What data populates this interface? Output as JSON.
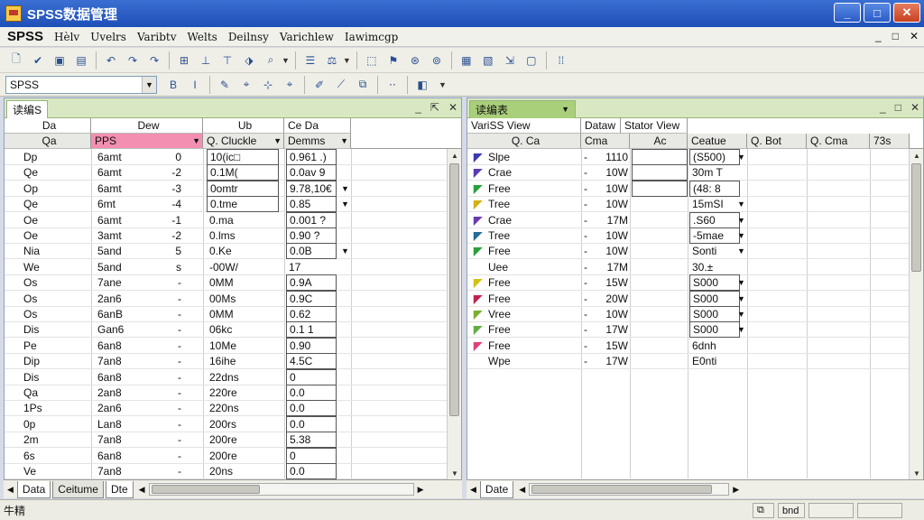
{
  "app": {
    "title": "SPSS数据管理"
  },
  "window_controls": [
    "_",
    "□",
    "✕"
  ],
  "menu": {
    "logo": "SPSS",
    "items": [
      "Hèlv",
      "Uvelrs",
      "Varibtv",
      "Welts",
      "Deilnsy",
      "Varichlew",
      "Iawimcgp"
    ],
    "mdi_controls": [
      "_",
      "□",
      "✕"
    ]
  },
  "toolbar1": {
    "buttons": [
      {
        "name": "new-icon",
        "glyph": "🗋"
      },
      {
        "name": "checkmark-icon",
        "glyph": "✔"
      },
      {
        "name": "save-icon",
        "glyph": "▣"
      },
      {
        "name": "print-icon",
        "glyph": "▤"
      },
      {
        "name": "undo-icon",
        "glyph": "↶"
      },
      {
        "name": "redo-icon",
        "glyph": "↷"
      },
      {
        "name": "goto-icon",
        "glyph": "↷"
      },
      {
        "name": "variables-icon",
        "glyph": "⊞"
      },
      {
        "name": "insert-case-icon",
        "glyph": "⊥"
      },
      {
        "name": "insert-variable-icon",
        "glyph": "⊤"
      },
      {
        "name": "split-icon",
        "glyph": "⬗"
      },
      {
        "name": "find-icon",
        "glyph": "⌕"
      },
      {
        "name": "list-icon",
        "glyph": "☰"
      },
      {
        "name": "weight-icon",
        "glyph": "⚖"
      },
      {
        "name": "select-icon",
        "glyph": "⬚"
      },
      {
        "name": "value-labels-icon",
        "glyph": "⚑"
      },
      {
        "name": "use-sets-icon",
        "glyph": "⊛"
      },
      {
        "name": "scripts-icon",
        "glyph": "⊚"
      },
      {
        "name": "chart-icon",
        "glyph": "▦"
      },
      {
        "name": "table-icon",
        "glyph": "▧"
      },
      {
        "name": "export-icon",
        "glyph": "⇲"
      },
      {
        "name": "output-icon",
        "glyph": "▢"
      },
      {
        "name": "grid-icon",
        "glyph": "⁞⁞"
      }
    ]
  },
  "toolbar2": {
    "combo_value": "SPSS",
    "buttons": [
      {
        "name": "bold-icon",
        "glyph": "B"
      },
      {
        "name": "italic-icon",
        "glyph": "I"
      },
      {
        "name": "edit-icon",
        "glyph": "✎"
      },
      {
        "name": "format-icon",
        "glyph": "⌖"
      },
      {
        "name": "align-icon",
        "glyph": "⊹"
      },
      {
        "name": "pin-icon",
        "glyph": "⌖"
      },
      {
        "name": "pencil-icon",
        "glyph": "✐"
      },
      {
        "name": "arrange-icon",
        "glyph": "⟋"
      },
      {
        "name": "copy-icon",
        "glyph": "⧉"
      },
      {
        "name": "dots-icon",
        "glyph": "⋅⋅"
      },
      {
        "name": "palette-icon",
        "glyph": "◧"
      }
    ]
  },
  "left_pane": {
    "tab": "读编S",
    "controls": [
      "_",
      "⇱",
      "✕"
    ],
    "header_top": [
      "Da",
      "Dew",
      "Ub",
      "Ce  Da"
    ],
    "header_bottom": [
      "Qa",
      "PPS",
      "Q. Cluckle",
      "Demms"
    ],
    "rows": [
      {
        "c1": "Dp",
        "c2": "6amt",
        "c3": "0",
        "c4": "10(ic□",
        "c5": "0.961 .)",
        "dd": ""
      },
      {
        "c1": "Qe",
        "c2": "6amt",
        "c3": "-2",
        "c4": "0.1M(",
        "c5": "0.0av 9",
        "dd": ""
      },
      {
        "c1": "Op",
        "c2": "6amt",
        "c3": "-3",
        "c4": "0omtr",
        "c5": "9.78,10€",
        "dd": "▼"
      },
      {
        "c1": "Qe",
        "c2": "6mt",
        "c3": "-4",
        "c4": "0.tme",
        "c5": "0.85",
        "dd": "▼"
      },
      {
        "c1": "Oe",
        "c2": "6amt",
        "c3": "-1",
        "c4": "0.ma",
        "c5": "0.001 ?",
        "dd": ""
      },
      {
        "c1": "Oe",
        "c2": "3amt",
        "c3": "-2",
        "c4": "0.lms",
        "c5": "0.90  ?",
        "dd": ""
      },
      {
        "c1": "Nia",
        "c2": "5and",
        "c3": "5",
        "c4": "0.Ke",
        "c5": "0.0B",
        "dd": "▼"
      },
      {
        "c1": "We",
        "c2": "5and",
        "c3": "s",
        "c4": "-00W/",
        "c5": "17",
        "dd": ""
      },
      {
        "c1": "Os",
        "c2": "7ane",
        "c3": "-",
        "c4": "0MM",
        "c5": "0.9A",
        "dd": ""
      },
      {
        "c1": "Os",
        "c2": "2an6",
        "c3": "-",
        "c4": "00Ms",
        "c5": "0.9C",
        "dd": ""
      },
      {
        "c1": "Os",
        "c2": "6anB",
        "c3": "-",
        "c4": "0MM",
        "c5": "0.62",
        "dd": ""
      },
      {
        "c1": "Dis",
        "c2": "Gan6",
        "c3": "-",
        "c4": "06kc",
        "c5": "0.1   1",
        "dd": ""
      },
      {
        "c1": "Pe",
        "c2": "6an8",
        "c3": "-",
        "c4": "10Me",
        "c5": "0.90",
        "dd": ""
      },
      {
        "c1": "Dip",
        "c2": "7an8",
        "c3": "-",
        "c4": "16ihe",
        "c5": "4.5C",
        "dd": ""
      },
      {
        "c1": "Dis",
        "c2": "6an8",
        "c3": "-",
        "c4": "22dns",
        "c5": "0",
        "dd": ""
      },
      {
        "c1": "Qa",
        "c2": "2an8",
        "c3": "-",
        "c4": "220re",
        "c5": "0.0",
        "dd": ""
      },
      {
        "c1": "1Ps",
        "c2": "2an6",
        "c3": "-",
        "c4": "220ns",
        "c5": "0.0",
        "dd": ""
      },
      {
        "c1": "0p",
        "c2": "Lan8",
        "c3": "-",
        "c4": "200rs",
        "c5": "0.0",
        "dd": ""
      },
      {
        "c1": "2m",
        "c2": "7an8",
        "c3": "-",
        "c4": "200re",
        "c5": "5.38",
        "dd": ""
      },
      {
        "c1": "6s",
        "c2": "6an8",
        "c3": "-",
        "c4": "200re",
        "c5": "0",
        "dd": ""
      },
      {
        "c1": "Ve",
        "c2": "7an8",
        "c3": "-",
        "c4": "20ns",
        "c5": "0.0",
        "dd": ""
      }
    ],
    "bottom_tabs": [
      "Data",
      "Ceitume",
      "Dte"
    ]
  },
  "right_pane": {
    "tab": "读编表",
    "controls": [
      "_",
      "□",
      "✕"
    ],
    "header_top": [
      "VariSS View",
      "Dataw",
      "Stator View"
    ],
    "header_bottom": [
      "Q. Ca",
      "Cma",
      "Ac",
      "Ceatue",
      "Q. Bot",
      "Q. Cma",
      "73s"
    ],
    "rows": [
      {
        "color": "#3a3ab0",
        "c1": "Slpe",
        "c2": "-",
        "c3": "1110",
        "c4": "(S500)",
        "dd": "▼"
      },
      {
        "color": "#5a3ab0",
        "c1": "Crae",
        "c2": "-",
        "c3": "10W",
        "c4": "30m T",
        "dd": ""
      },
      {
        "color": "#2aa03a",
        "c1": "Free",
        "c2": "-",
        "c3": "10W",
        "c4": "(48: 8",
        "dd": ""
      },
      {
        "color": "#d4b010",
        "c1": "Tree",
        "c2": "-",
        "c3": "10W",
        "c4": "15mSI",
        "dd": "▼"
      },
      {
        "color": "#6a3ab0",
        "c1": "Crae",
        "c2": "-",
        "c3": "17M",
        "c4": ".S60",
        "dd": "▼"
      },
      {
        "color": "#2a6a9a",
        "c1": "Tree",
        "c2": "-",
        "c3": "10W",
        "c4": "-5mae",
        "dd": "▼"
      },
      {
        "color": "#2aa03a",
        "c1": "Free",
        "c2": "-",
        "c3": "10W",
        "c4": "Sonti",
        "dd": "▼"
      },
      {
        "color": "",
        "c1": "Uee",
        "c2": "-",
        "c3": "17M",
        "c4": "30.±",
        "dd": ""
      },
      {
        "color": "#d4c010",
        "c1": "Free",
        "c2": "-",
        "c3": "15W",
        "c4": "S000",
        "dd": "▼"
      },
      {
        "color": "#c02050",
        "c1": "Free",
        "c2": "-",
        "c3": "20W",
        "c4": "S000",
        "dd": "▼"
      },
      {
        "color": "#7ab030",
        "c1": "Vree",
        "c2": "-",
        "c3": "10W",
        "c4": "S000",
        "dd": "▼"
      },
      {
        "color": "#60b040",
        "c1": "Free",
        "c2": "-",
        "c3": "17W",
        "c4": "S000",
        "dd": "▼"
      },
      {
        "color": "#e0407a",
        "c1": "Free",
        "c2": "-",
        "c3": "15W",
        "c4": "6dnh",
        "dd": ""
      },
      {
        "color": "",
        "c1": "Wpe",
        "c2": "-",
        "c3": "17W",
        "c4": "E0nti",
        "dd": ""
      }
    ],
    "bottom_tabs": [
      "Date"
    ]
  },
  "status": {
    "left": "牛精",
    "panes": [
      "",
      "bnd",
      "",
      ""
    ]
  }
}
